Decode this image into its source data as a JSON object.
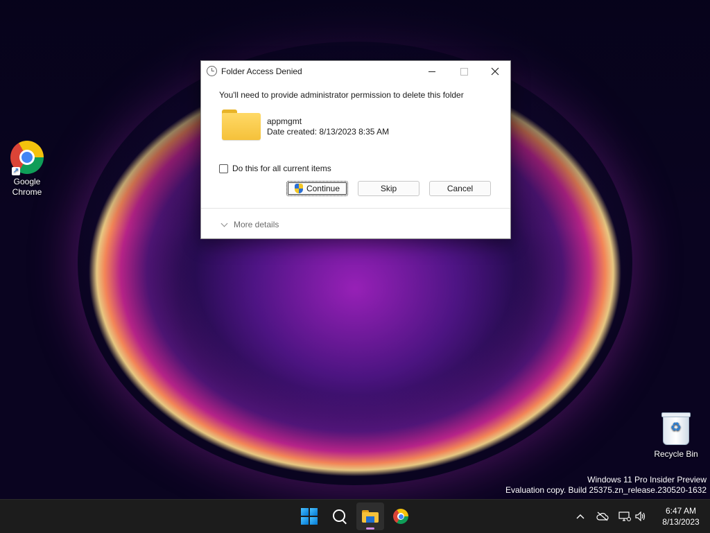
{
  "desktop": {
    "icons": [
      {
        "label_line1": "Google",
        "label_line2": "Chrome"
      },
      {
        "label": "Recycle Bin"
      }
    ],
    "watermark": {
      "line1": "Windows 11 Pro Insider Preview",
      "line2": "Evaluation copy. Build 25375.zn_release.230520-1632"
    }
  },
  "dialog": {
    "title": "Folder Access Denied",
    "message": "You'll need to provide administrator permission to delete this folder",
    "folder_name": "appmgmt",
    "date_created": "Date created: 8/13/2023 8:35 AM",
    "checkbox_label": "Do this for all current items",
    "checkbox_checked": false,
    "buttons": {
      "continue": "Continue",
      "skip": "Skip",
      "cancel": "Cancel"
    },
    "more_details": "More details",
    "window_controls": {
      "minimize": "minimize-icon",
      "maximize": "maximize-icon",
      "close": "close-icon"
    }
  },
  "taskbar": {
    "pinned": [
      {
        "name": "start",
        "icon": "windows-logo-icon"
      },
      {
        "name": "search",
        "icon": "search-icon"
      },
      {
        "name": "file-explorer",
        "icon": "folder-icon",
        "active": true
      },
      {
        "name": "chrome",
        "icon": "chrome-icon"
      }
    ],
    "tray_icons": [
      "chevron-up-icon",
      "cloud-offline-icon",
      "network-icon",
      "volume-icon"
    ],
    "clock": {
      "time": "6:47 AM",
      "date": "8/13/2023"
    }
  },
  "colors": {
    "accent": "#0078d4",
    "taskbar_bg": "#1c1c1c",
    "dialog_bg": "#ffffff"
  }
}
